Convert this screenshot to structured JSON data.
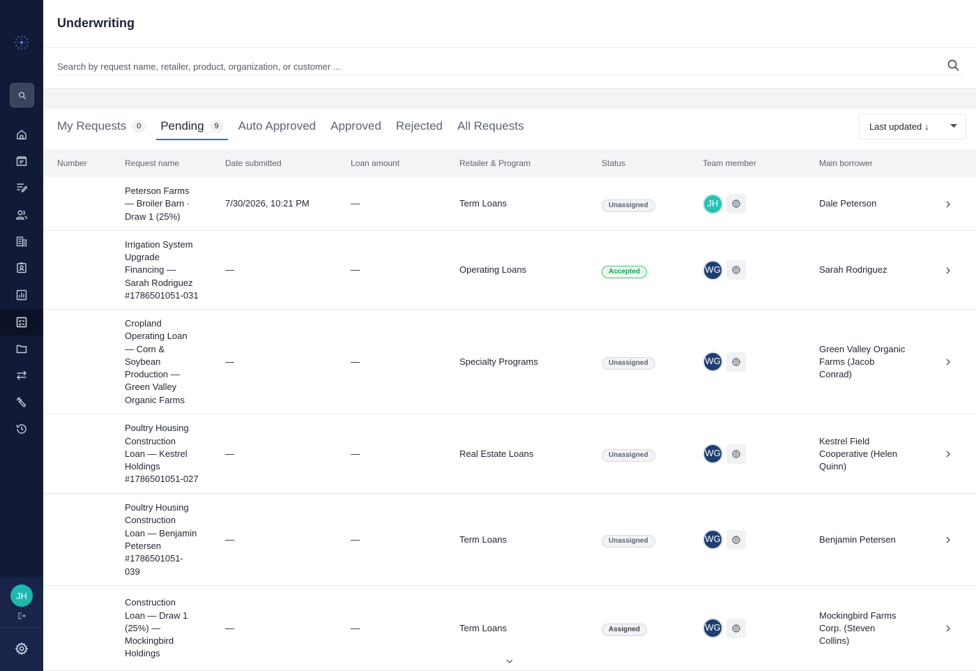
{
  "page": {
    "title": "Underwriting"
  },
  "search": {
    "placeholder": "Search by request name, retailer, product, organization, or customer ..."
  },
  "sidebar": {
    "icons": [
      "search-icon",
      "home-icon",
      "inbox-icon",
      "edit-list-icon",
      "users-icon",
      "building-icon",
      "id-badge-icon",
      "chart-icon",
      "checklist-icon",
      "folder-icon",
      "transfer-icon",
      "wrench-icon",
      "history-icon"
    ],
    "active": "checklist-icon",
    "user_initials": "JH"
  },
  "tabs": [
    {
      "label": "My Requests",
      "count": "0"
    },
    {
      "label": "Pending",
      "count": "9"
    },
    {
      "label": "Auto Approved"
    },
    {
      "label": "Approved"
    },
    {
      "label": "Rejected"
    },
    {
      "label": "All Requests"
    }
  ],
  "active_tab": "Pending",
  "sort": {
    "label": "Last updated",
    "arrow": "↓"
  },
  "table": {
    "columns": [
      "Number",
      "Request name",
      "Date submitted",
      "Loan amount",
      "Retailer & Program",
      "Status",
      "Team member",
      "Main borrower"
    ],
    "rows": [
      {
        "number": "",
        "name_lines": [
          "Peterson Farms",
          "— Broiler Barn ·",
          "Draw 1 (25%)"
        ],
        "date": "7/30/2026, 10:21 PM",
        "amount": "—",
        "program": "Term Loans",
        "status": "Unassigned",
        "team_initials": "JH",
        "team_color": "#2bc0b6",
        "borrower_lines": [
          "Dale Peterson"
        ]
      },
      {
        "number": "",
        "name_lines": [
          "Irrigation System",
          "Upgrade",
          "Financing —",
          "Sarah Rodriguez",
          "#1786501051-031"
        ],
        "date": "—",
        "amount": "—",
        "program": "Operating Loans",
        "status": "Accepted",
        "team_initials": "WG",
        "team_color": "#1f3f73",
        "borrower_lines": [
          "Sarah Rodriguez"
        ]
      },
      {
        "number": "",
        "name_lines": [
          "Cropland",
          "Operating Loan",
          "— Corn &",
          "Soybean",
          "Production —",
          "Green Valley",
          "Organic Farms"
        ],
        "date": "—",
        "amount": "—",
        "program": "Specialty Programs",
        "status": "Unassigned",
        "team_initials": "WG",
        "team_color": "#1f3f73",
        "borrower_lines": [
          "Green Valley Organic",
          "Farms (Jacob",
          "Conrad)"
        ]
      },
      {
        "number": "",
        "name_lines": [
          "Poultry Housing",
          "Construction",
          "Loan — Kestrel",
          "Holdings",
          "#1786501051-027"
        ],
        "date": "—",
        "amount": "—",
        "program": "Real Estate Loans",
        "status": "Unassigned",
        "team_initials": "WG",
        "team_color": "#1f3f73",
        "borrower_lines": [
          "Kestrel Field",
          "Cooperative (Helen",
          "Quinn)"
        ]
      },
      {
        "number": "",
        "name_lines": [
          "Poultry Housing",
          "Construction",
          "Loan — Benjamin",
          "Petersen",
          "#1786501051-",
          "039"
        ],
        "date": "—",
        "amount": "—",
        "program": "Term Loans",
        "status": "Unassigned",
        "team_initials": "WG",
        "team_color": "#1f3f73",
        "borrower_lines": [
          "Benjamin Petersen"
        ]
      },
      {
        "number": "",
        "name_lines": [
          "Construction",
          "Loan — Draw 1",
          "(25%) —",
          "Mockingbird",
          "Holdings"
        ],
        "date": "—",
        "amount": "—",
        "program": "Term Loans",
        "status": "Assigned",
        "team_initials": "WG",
        "team_color": "#1f3f73",
        "borrower_lines": [
          "Mockingbird Farms",
          "Corp. (Steven",
          "Collins)"
        ]
      }
    ]
  }
}
